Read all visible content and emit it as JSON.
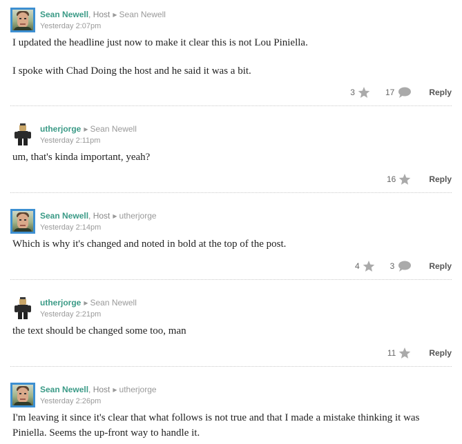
{
  "comments": [
    {
      "author": "Sean Newell",
      "role": ", Host",
      "reply_to": "Sean Newell",
      "time": "Yesterday 2:07pm",
      "paragraphs": [
        "I updated the headline just now to make it clear this is not Lou Piniella.",
        "I spoke with Chad Doing the host and he said it was a bit."
      ],
      "stars": "3",
      "replies": "17",
      "reply_label": "Reply"
    },
    {
      "author": "utherjorge",
      "role": "",
      "reply_to": "Sean Newell",
      "time": "Yesterday 2:11pm",
      "paragraphs": [
        "um, that's kinda important, yeah?"
      ],
      "stars": "16",
      "replies": "",
      "reply_label": "Reply"
    },
    {
      "author": "Sean Newell",
      "role": ", Host",
      "reply_to": "utherjorge",
      "time": "Yesterday 2:14pm",
      "paragraphs": [
        "Which is why it's changed and noted in bold at the top of the post."
      ],
      "stars": "4",
      "replies": "3",
      "reply_label": "Reply"
    },
    {
      "author": "utherjorge",
      "role": "",
      "reply_to": "Sean Newell",
      "time": "Yesterday 2:21pm",
      "paragraphs": [
        "the text should be changed some too, man"
      ],
      "stars": "11",
      "replies": "",
      "reply_label": "Reply"
    },
    {
      "author": "Sean Newell",
      "role": ", Host",
      "reply_to": "utherjorge",
      "time": "Yesterday 2:26pm",
      "paragraphs": [
        "I'm leaving it since it's clear that what follows is not true and that I made a mistake thinking it was Piniella. Seems the up-front way to handle it."
      ],
      "stars": "",
      "replies": "",
      "reply_label": ""
    }
  ],
  "icons": {
    "star": "star-icon",
    "bubble": "speech-bubble-icon",
    "arrow": "caret-right-icon"
  },
  "colors": {
    "author": "#3a9a86",
    "avatar_border": "#3d8fd1",
    "icon_gray": "#aaaaaa",
    "divider": "#c8c8c8"
  }
}
